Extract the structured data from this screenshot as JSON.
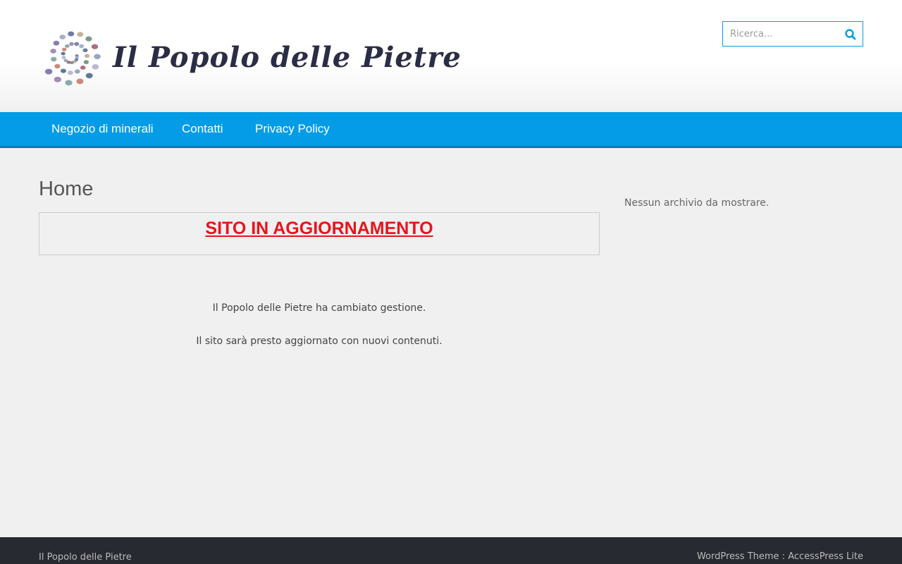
{
  "header": {
    "site_name": "Il Popolo delle Pietre",
    "logo_icon": "stone-spiral-logo-icon",
    "search": {
      "placeholder": "Ricerca...",
      "value": "",
      "icon": "search-icon",
      "accent_color": "#049ce6"
    }
  },
  "nav": {
    "background_color": "#049ce6",
    "items": [
      {
        "label": "Negozio di minerali"
      },
      {
        "label": "Contatti"
      },
      {
        "label": "Privacy Policy"
      }
    ]
  },
  "main": {
    "title": "Home",
    "notice": "SITO IN AGGIORNAMENTO",
    "notice_color": "#e8141b",
    "paragraphs": [
      "Il Popolo delle Pietre ha cambiato gestione.",
      "Il sito sarà presto aggiornato con nuovi contenuti."
    ]
  },
  "sidebar": {
    "archive_empty": "Nessun archivio da mostrare."
  },
  "footer": {
    "left_text": "Il Popolo delle Pietre",
    "right_prefix": "WordPress Theme : ",
    "right_link": "AccessPress Lite",
    "background_color": "#272a31"
  }
}
